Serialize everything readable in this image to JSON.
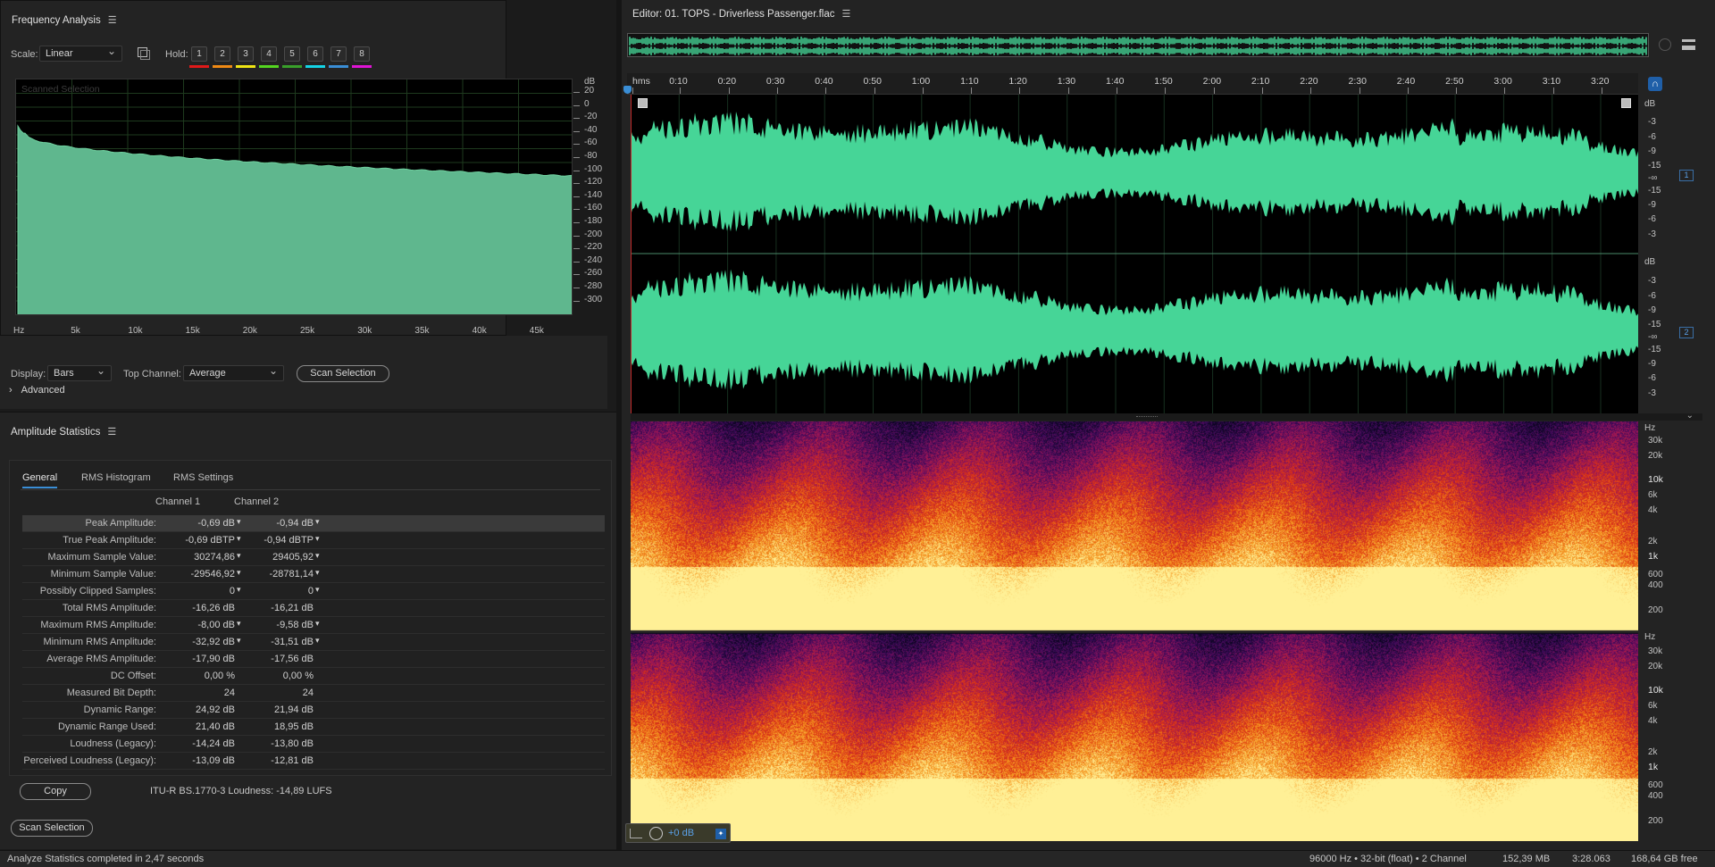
{
  "freq": {
    "title": "Frequency Analysis",
    "scale_label": "Scale:",
    "scale_value": "Linear",
    "hold_label": "Hold:",
    "holds": [
      "1",
      "2",
      "3",
      "4",
      "5",
      "6",
      "7",
      "8"
    ],
    "hold_colors": [
      "#e01919",
      "#f08a14",
      "#f0e514",
      "#55d620",
      "#39a02a",
      "#14d4e6",
      "#3a8ed6",
      "#e014d6"
    ],
    "overlay_text": "Scanned Selection",
    "y_unit": "dB",
    "y_ticks": [
      "20",
      "0",
      "-20",
      "-40",
      "-60",
      "-80",
      "-100",
      "-120",
      "-140",
      "-160",
      "-180",
      "-200",
      "-220",
      "-240",
      "-260",
      "-280",
      "-300"
    ],
    "x_ticks": [
      "Hz",
      "5k",
      "10k",
      "15k",
      "20k",
      "25k",
      "30k",
      "35k",
      "40k",
      "45k"
    ],
    "display_label": "Display:",
    "display_value": "Bars",
    "top_channel_label": "Top Channel:",
    "top_channel_value": "Average",
    "scan_button": "Scan Selection",
    "advanced": "Advanced",
    "fill_color": "#5fb78e"
  },
  "amp": {
    "title": "Amplitude Statistics",
    "tabs": [
      "General",
      "RMS Histogram",
      "RMS Settings"
    ],
    "col1": "Channel 1",
    "col2": "Channel 2",
    "rows": [
      {
        "k": "Peak Amplitude:",
        "v1": "-0,69 dB",
        "v2": "-0,94 dB",
        "nav": true
      },
      {
        "k": "True Peak Amplitude:",
        "v1": "-0,69 dBTP",
        "v2": "-0,94 dBTP",
        "nav": true
      },
      {
        "k": "Maximum Sample Value:",
        "v1": "30274,86",
        "v2": "29405,92",
        "nav": true
      },
      {
        "k": "Minimum Sample Value:",
        "v1": "-29546,92",
        "v2": "-28781,14",
        "nav": true
      },
      {
        "k": "Possibly Clipped Samples:",
        "v1": "0",
        "v2": "0",
        "nav": true
      },
      {
        "k": "Total RMS Amplitude:",
        "v1": "-16,26 dB",
        "v2": "-16,21 dB",
        "nav": false
      },
      {
        "k": "Maximum RMS Amplitude:",
        "v1": "-8,00 dB",
        "v2": "-9,58 dB",
        "nav": true
      },
      {
        "k": "Minimum RMS Amplitude:",
        "v1": "-32,92 dB",
        "v2": "-31,51 dB",
        "nav": true
      },
      {
        "k": "Average RMS Amplitude:",
        "v1": "-17,90 dB",
        "v2": "-17,56 dB",
        "nav": false
      },
      {
        "k": "DC Offset:",
        "v1": "0,00 %",
        "v2": "0,00 %",
        "nav": false
      },
      {
        "k": "Measured Bit Depth:",
        "v1": "24",
        "v2": "24",
        "nav": false
      },
      {
        "k": "Dynamic Range:",
        "v1": "24,92 dB",
        "v2": "21,94 dB",
        "nav": false
      },
      {
        "k": "Dynamic Range Used:",
        "v1": "21,40 dB",
        "v2": "18,95 dB",
        "nav": false
      },
      {
        "k": "Loudness (Legacy):",
        "v1": "-14,24 dB",
        "v2": "-13,80 dB",
        "nav": false
      },
      {
        "k": "Perceived Loudness (Legacy):",
        "v1": "-13,09 dB",
        "v2": "-12,81 dB",
        "nav": false
      }
    ],
    "copy_button": "Copy",
    "loudness": "ITU-R BS.1770-3 Loudness: -14,89 LUFS",
    "scan_button": "Scan Selection"
  },
  "editor": {
    "title": "Editor: 01. TOPS - Driverless Passenger.flac",
    "timeline": [
      "hms",
      "0:10",
      "0:20",
      "0:30",
      "0:40",
      "0:50",
      "1:00",
      "1:10",
      "1:20",
      "1:30",
      "1:40",
      "1:50",
      "2:00",
      "2:10",
      "2:20",
      "2:30",
      "2:40",
      "2:50",
      "3:00",
      "3:10",
      "3:20"
    ],
    "db_unit": "dB",
    "db_ticks": [
      "-3",
      "-6",
      "-9",
      "-15",
      "-∞",
      "-15",
      "-9",
      "-6",
      "-3"
    ],
    "ch1_badge": "1",
    "ch2_badge": "2",
    "hz_unit": "Hz",
    "hz_ticks": [
      "30k",
      "20k",
      "10k",
      "6k",
      "4k",
      "2k",
      "1k",
      "600",
      "400",
      "200"
    ],
    "wave_color": "#46d597",
    "volume": "+0 dB"
  },
  "status": {
    "left": "Analyze Statistics completed in 2,47 seconds",
    "sample": "96000 Hz • 32-bit (float) • 2 Channel",
    "size": "152,39 MB",
    "duration": "3:28.063",
    "free": "168,64 GB free"
  }
}
